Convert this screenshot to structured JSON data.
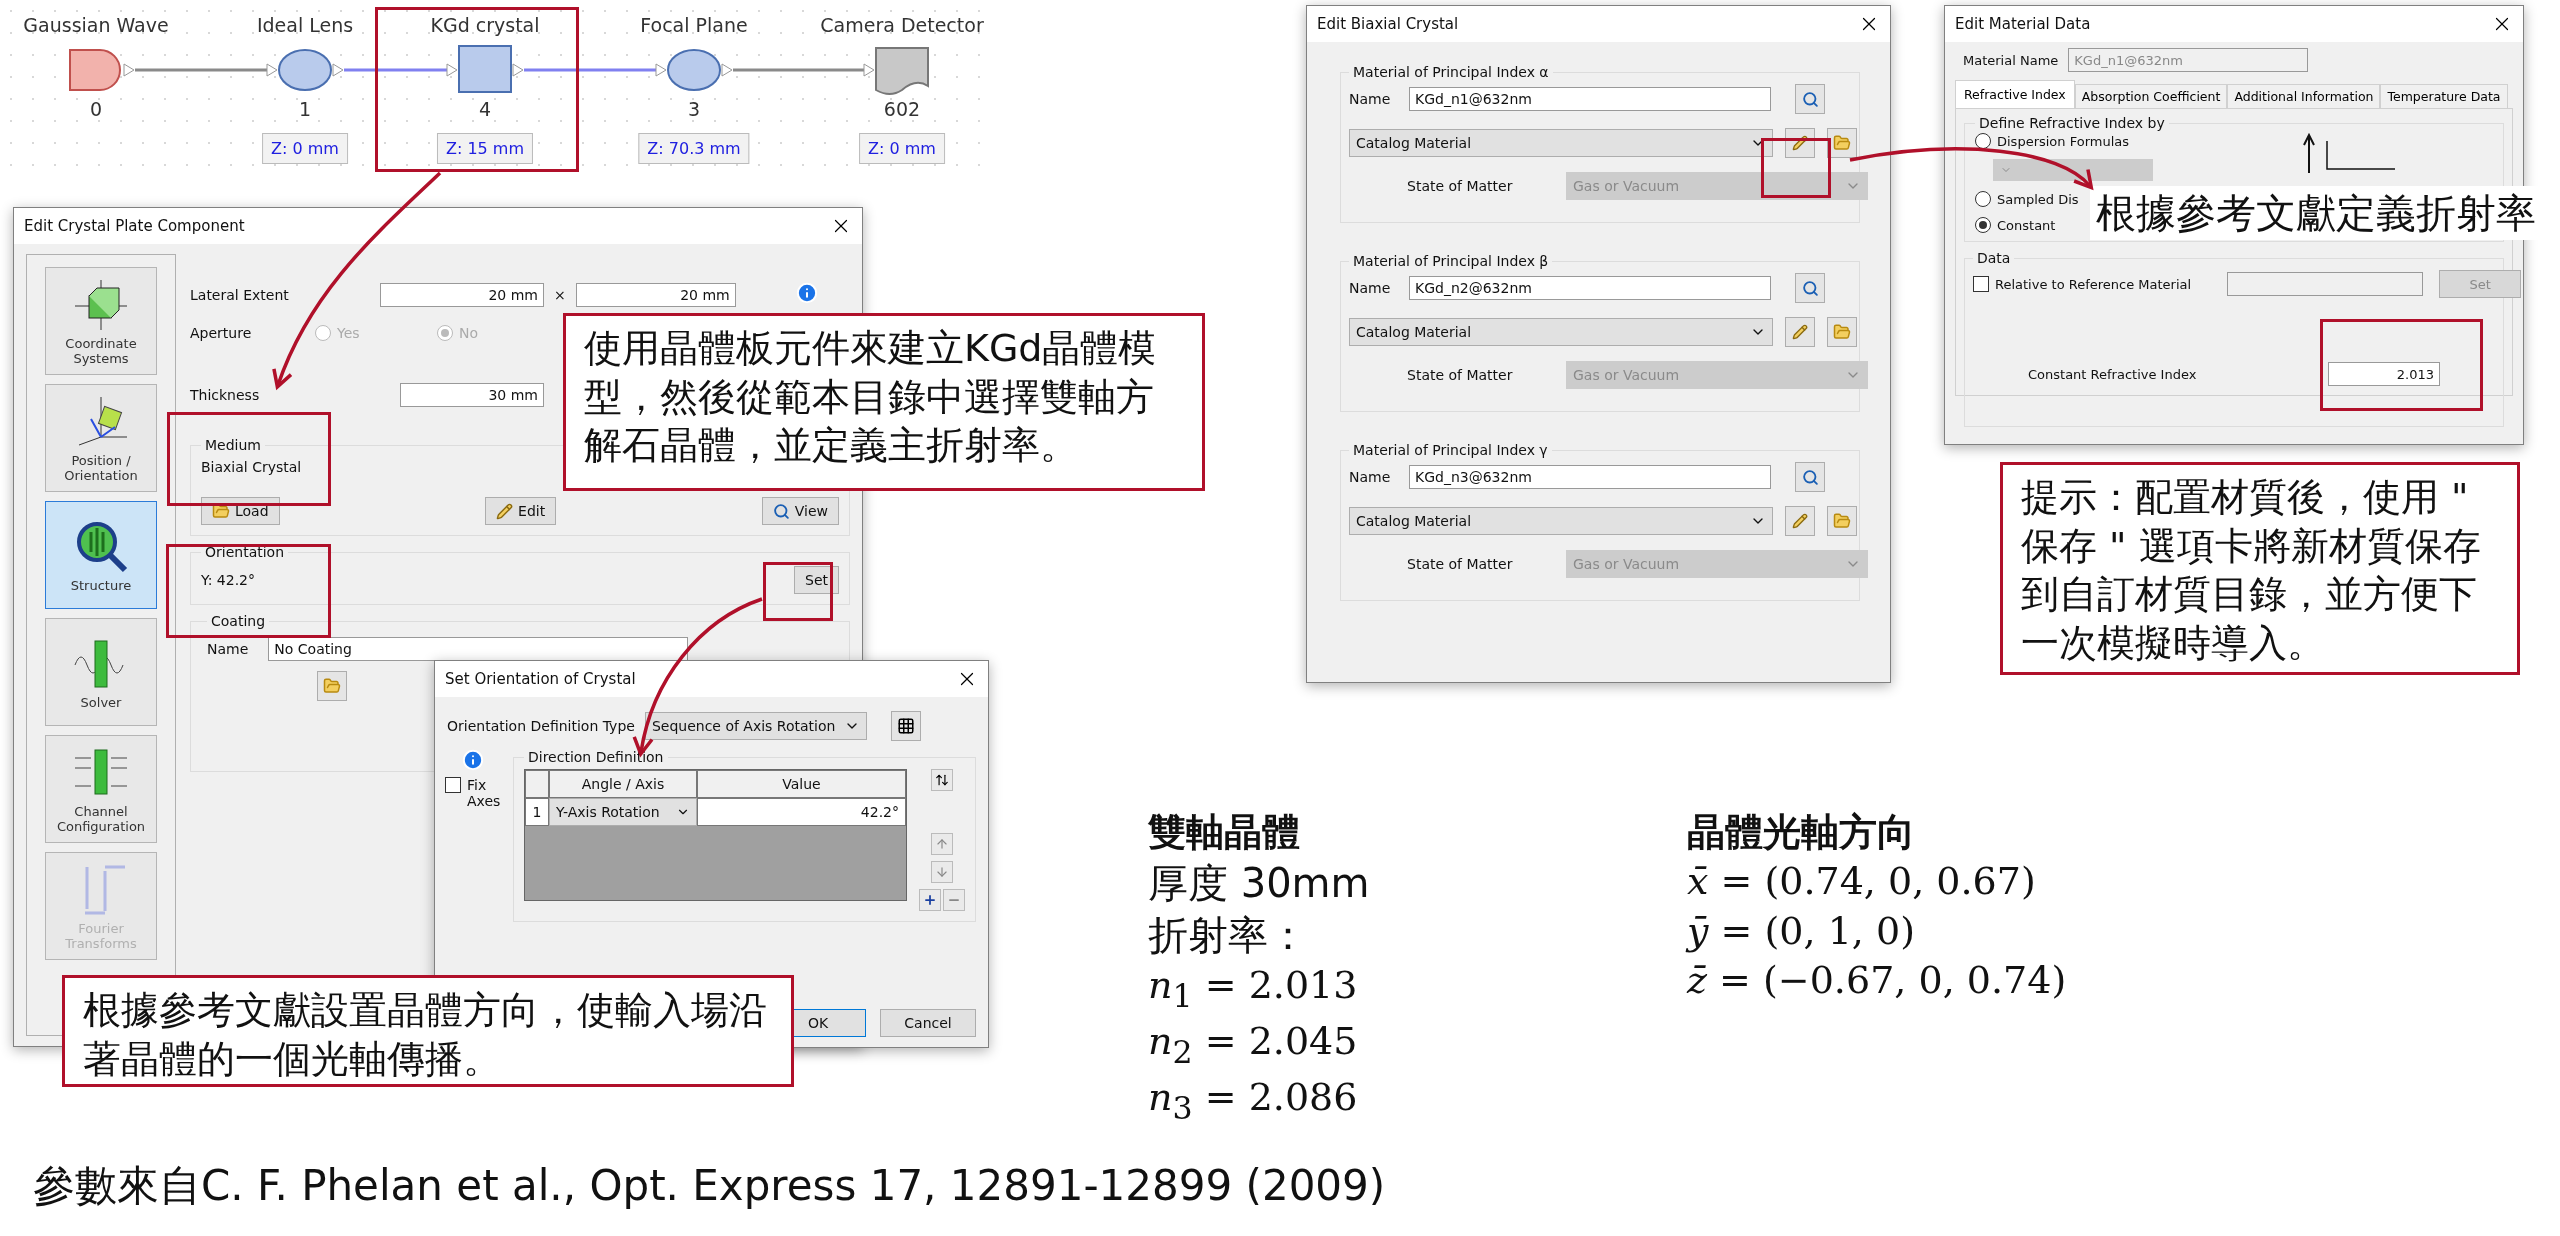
{
  "flow": {
    "nodes": [
      {
        "kind": "source",
        "label": "Gaussian Wave",
        "index": "0"
      },
      {
        "kind": "lens",
        "label": "Ideal Lens",
        "index": "1",
        "z": "Z: 0 mm"
      },
      {
        "kind": "crystal",
        "label": "KGd crystal",
        "index": "4",
        "z": "Z: 15 mm"
      },
      {
        "kind": "lens",
        "label": "Focal Plane",
        "index": "3",
        "z": "Z: 70.3 mm"
      },
      {
        "kind": "detector",
        "label": "Camera Detector",
        "index": "602",
        "z": "Z: 0 mm"
      }
    ],
    "links": [
      {
        "color": "#8a8a8a"
      },
      {
        "color": "#8080f0"
      },
      {
        "color": "#8080f0"
      },
      {
        "color": "#8a8a8a"
      }
    ]
  },
  "crystal_window": {
    "title": "Edit Crystal Plate Component",
    "nav": [
      {
        "kind": "coordinates",
        "label": "Coordinate Systems",
        "selected": false,
        "disabled": false
      },
      {
        "kind": "position",
        "label": "Position / Orientation",
        "selected": false,
        "disabled": false
      },
      {
        "kind": "structure",
        "label": "Structure",
        "selected": true,
        "disabled": false
      },
      {
        "kind": "solver",
        "label": "Solver",
        "selected": false,
        "disabled": false
      },
      {
        "kind": "channel",
        "label": "Channel Configuration",
        "selected": false,
        "disabled": false
      },
      {
        "kind": "fourier",
        "label": "Fourier Transforms",
        "selected": false,
        "disabled": true
      }
    ],
    "lateral_extent": {
      "label": "Lateral Extent",
      "width": "20 mm",
      "separator": "×",
      "height": "20 mm"
    },
    "aperture": {
      "label": "Aperture",
      "disabled": true,
      "options": [
        {
          "label": "Yes",
          "selected": false
        },
        {
          "label": "No",
          "selected": true
        }
      ]
    },
    "thickness": {
      "label": "Thickness",
      "value": "30 mm"
    },
    "medium": {
      "legend": "Medium",
      "value": "Biaxial Crystal",
      "buttons": [
        {
          "kind": "load",
          "label": "Load"
        },
        {
          "kind": "edit",
          "label": "Edit"
        },
        {
          "kind": "view",
          "label": "View"
        }
      ]
    },
    "orientation": {
      "legend": "Orientation",
      "value": "Y: 42.2°",
      "button": "Set"
    },
    "coating": {
      "legend": "Coating",
      "name_label": "Name",
      "value": "No Coating"
    }
  },
  "orientation_window": {
    "title": "Set Orientation of Crystal",
    "type_label": "Orientation Definition Type",
    "type_value": "Sequence of Axis Rotation",
    "fix_axes": {
      "label": "Fix Axes",
      "checked": false
    },
    "legend": "Direction Definition",
    "columns": [
      "Angle / Axis",
      "Value"
    ],
    "rows": [
      {
        "index": "1",
        "axis": "Y-Axis Rotation",
        "value": "42.2°"
      }
    ],
    "buttons": [
      {
        "label": "OK",
        "default": true
      },
      {
        "label": "Cancel",
        "default": false
      }
    ]
  },
  "biaxial_window": {
    "title": "Edit Biaxial Crystal",
    "groups": [
      {
        "legend": "Material of Principal Index α",
        "name_label": "Name",
        "name": "KGd_n1@632nm",
        "type": "Catalog Material",
        "state_label": "State of Matter",
        "state": "Gas or Vacuum",
        "state_disabled": true
      },
      {
        "legend": "Material of Principal Index β",
        "name_label": "Name",
        "name": "KGd_n2@632nm",
        "type": "Catalog Material",
        "state_label": "State of Matter",
        "state": "Gas or Vacuum",
        "state_disabled": true
      },
      {
        "legend": "Material of Principal Index γ",
        "name_label": "Name",
        "name": "KGd_n3@632nm",
        "type": "Catalog Material",
        "state_label": "State of Matter",
        "state": "Gas or Vacuum",
        "state_disabled": true
      }
    ]
  },
  "material_window": {
    "title": "Edit Material Data",
    "name_label": "Material Name",
    "name": "KGd_n1@632nm",
    "tabs": [
      {
        "label": "Refractive Index",
        "selected": true
      },
      {
        "label": "Absorption Coefficient",
        "selected": false
      },
      {
        "label": "Additional Information",
        "selected": false
      },
      {
        "label": "Temperature Data",
        "selected": false
      }
    ],
    "define_legend": "Define Refractive Index by",
    "options": [
      {
        "label": "Dispersion Formulas",
        "selected": false
      },
      {
        "label": "Sampled Dis",
        "selected": false
      },
      {
        "label": "Constant",
        "selected": true
      }
    ],
    "data_legend": "Data",
    "relative": {
      "label": "Relative to Reference Material",
      "checked": false
    },
    "set_button": {
      "label": "Set",
      "disabled": true
    },
    "constant_label": "Constant Refractive Index",
    "constant_value": "2.013"
  },
  "callouts": [
    {
      "kind": "boxed",
      "text": "使用晶體板元件來建立KGd晶體模型，然後從範本目錄中選擇雙軸方解石晶體，並定義主折射率。"
    },
    {
      "kind": "boxed",
      "text": "根據參考文獻設置晶體方向，使輸入場沿著晶體的一個光軸傳播。"
    },
    {
      "kind": "plain",
      "text": "根據參考文獻定義折射率"
    },
    {
      "kind": "boxed",
      "text": "提示：配置材質後，使用 \" 保存 \" 選項卡將新材質保存到自訂材質目錄，並方便下一次模擬時導入。"
    }
  ],
  "notes": [
    {
      "title": "雙軸晶體",
      "lines": [
        {
          "kind": "text",
          "text": "厚度 30mm"
        },
        {
          "kind": "text",
          "text": "折射率："
        },
        {
          "kind": "math",
          "text": "*n*$_{1}$ = 2.013"
        },
        {
          "kind": "math",
          "text": "*n*$_{2}$ = 2.045"
        },
        {
          "kind": "math",
          "text": "*n*$_{3}$ = 2.086"
        }
      ]
    },
    {
      "title": "晶體光軸方向",
      "lines": [
        {
          "kind": "math",
          "text": "*x̄* = (0.74, 0, 0.67)"
        },
        {
          "kind": "math",
          "text": "*ȳ* = (0, 1, 0)"
        },
        {
          "kind": "math",
          "text": "*z̄* = (−0.67, 0, 0.74)"
        }
      ]
    }
  ],
  "reference": "參數來自C. F. Phelan et al., Opt. Express 17, 12891-12899 (2009)"
}
